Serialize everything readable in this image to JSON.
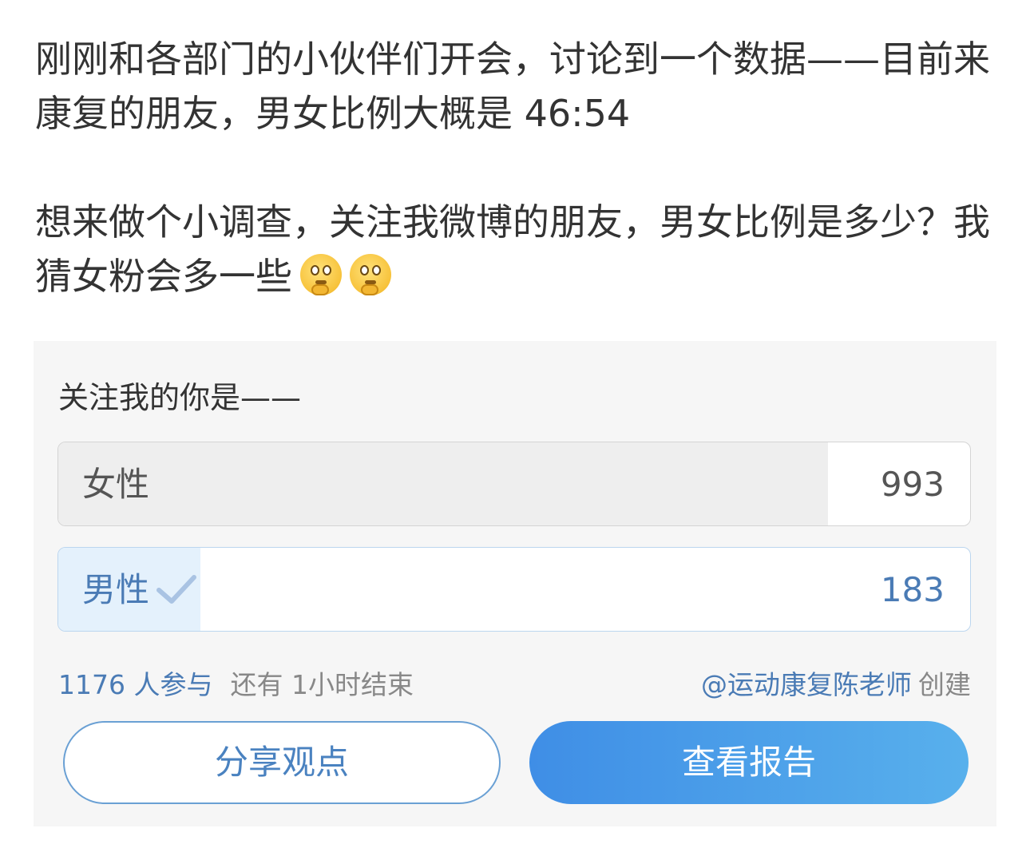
{
  "post": {
    "paragraph1": "刚刚和各部门的小伙伴们开会，讨论到一个数据——目前来康复的朋友，男女比例大概是 46:54",
    "paragraph2": "想来做个小调查，关注我微博的朋友，男女比例是多少？我猜女粉会多一些",
    "emojis": [
      "thinking-face-icon",
      "thinking-face-icon"
    ]
  },
  "poll": {
    "title": "关注我的你是——",
    "options": [
      {
        "label": "女性",
        "count": "993",
        "fraction": 0.844
      },
      {
        "label": "男性",
        "count": "183",
        "fraction": 0.156,
        "selected": true
      }
    ],
    "participants": "1176 人参与",
    "remaining": "还有 1小时结束",
    "creator": "@运动康复陈老师",
    "creator_suffix": "创建",
    "share_button": "分享观点",
    "report_button": "查看报告"
  },
  "colors": {
    "accent": "#4a7bb5",
    "selected_fill": "#e4f1fc",
    "unselected_fill": "#eeeeee",
    "button_gradient_start": "#3f8ee6",
    "button_gradient_end": "#58b0ec"
  }
}
